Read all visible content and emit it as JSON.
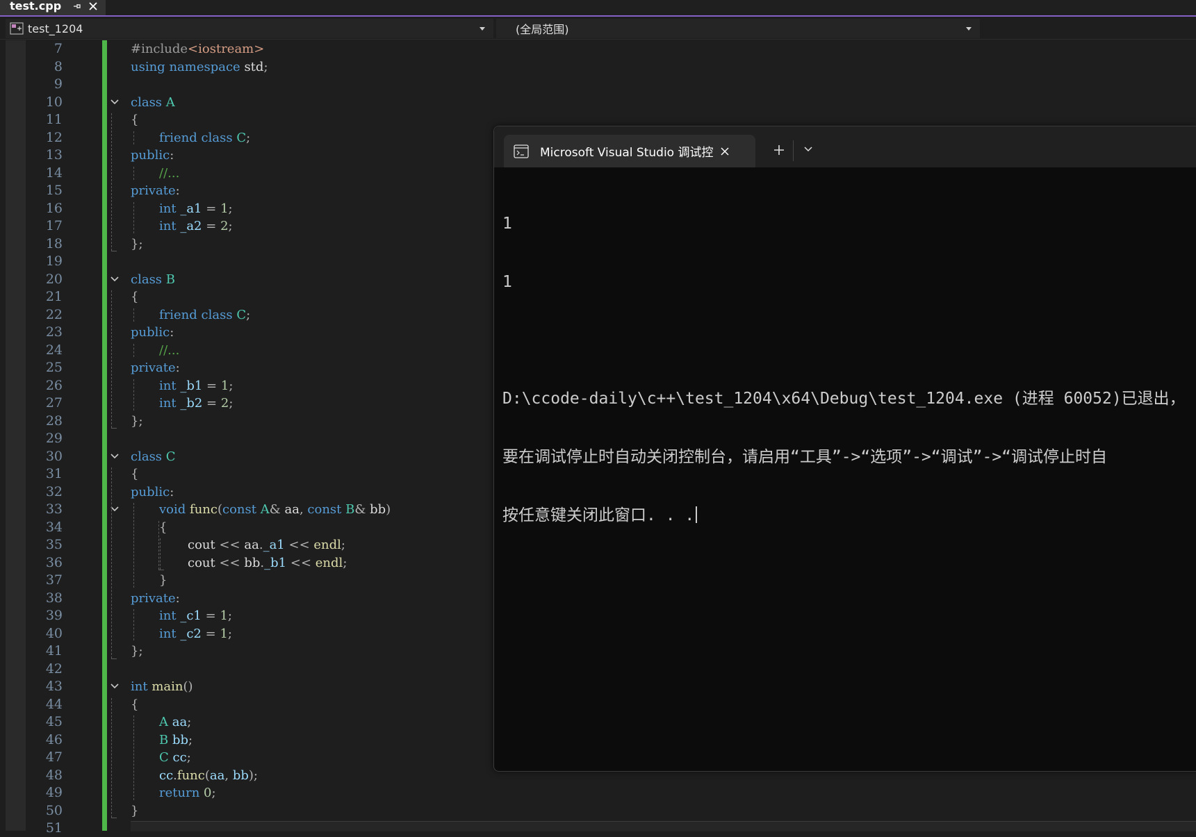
{
  "editor_tab": {
    "title": "test.cpp"
  },
  "navbar": {
    "project": "test_1204",
    "scope": "(全局范围)"
  },
  "editor": {
    "lines": [
      {
        "n": "7",
        "indent": 0,
        "tokens": [
          [
            "t-pre",
            "#include"
          ],
          [
            "t-str",
            "<iostream>"
          ]
        ]
      },
      {
        "n": "8",
        "indent": 0,
        "tokens": [
          [
            "t-kw",
            "using"
          ],
          [
            "t-pl",
            " "
          ],
          [
            "t-kw",
            "namespace"
          ],
          [
            "t-pl",
            " std"
          ],
          [
            "t-pun",
            ";"
          ]
        ]
      },
      {
        "n": "9",
        "indent": 0,
        "tokens": []
      },
      {
        "n": "10",
        "indent": 0,
        "fold": true,
        "tokens": [
          [
            "t-kw",
            "class"
          ],
          [
            "t-pl",
            " "
          ],
          [
            "t-type",
            "A"
          ]
        ]
      },
      {
        "n": "11",
        "indent": 0,
        "tokens": [
          [
            "t-pun",
            "{"
          ]
        ]
      },
      {
        "n": "12",
        "indent": 1,
        "tokens": [
          [
            "t-kw",
            "friend"
          ],
          [
            "t-pl",
            " "
          ],
          [
            "t-kw",
            "class"
          ],
          [
            "t-pl",
            " "
          ],
          [
            "t-type",
            "C"
          ],
          [
            "t-pun",
            ";"
          ]
        ]
      },
      {
        "n": "13",
        "indent": 0,
        "tokens": [
          [
            "t-kw",
            "public"
          ],
          [
            "t-pun",
            ":"
          ]
        ]
      },
      {
        "n": "14",
        "indent": 1,
        "tokens": [
          [
            "t-com",
            "//..."
          ]
        ]
      },
      {
        "n": "15",
        "indent": 0,
        "tokens": [
          [
            "t-kw",
            "private"
          ],
          [
            "t-pun",
            ":"
          ]
        ]
      },
      {
        "n": "16",
        "indent": 1,
        "tokens": [
          [
            "t-kw",
            "int"
          ],
          [
            "t-pl",
            " "
          ],
          [
            "t-var",
            "_a1"
          ],
          [
            "t-pl",
            " "
          ],
          [
            "t-pun",
            "="
          ],
          [
            "t-pl",
            " "
          ],
          [
            "t-num",
            "1"
          ],
          [
            "t-pun",
            ";"
          ]
        ]
      },
      {
        "n": "17",
        "indent": 1,
        "tokens": [
          [
            "t-kw",
            "int"
          ],
          [
            "t-pl",
            " "
          ],
          [
            "t-var",
            "_a2"
          ],
          [
            "t-pl",
            " "
          ],
          [
            "t-pun",
            "="
          ],
          [
            "t-pl",
            " "
          ],
          [
            "t-num",
            "2"
          ],
          [
            "t-pun",
            ";"
          ]
        ]
      },
      {
        "n": "18",
        "indent": 0,
        "tokens": [
          [
            "t-pun",
            "};"
          ]
        ]
      },
      {
        "n": "19",
        "indent": 0,
        "tokens": []
      },
      {
        "n": "20",
        "indent": 0,
        "fold": true,
        "tokens": [
          [
            "t-kw",
            "class"
          ],
          [
            "t-pl",
            " "
          ],
          [
            "t-type",
            "B"
          ]
        ]
      },
      {
        "n": "21",
        "indent": 0,
        "tokens": [
          [
            "t-pun",
            "{"
          ]
        ]
      },
      {
        "n": "22",
        "indent": 1,
        "tokens": [
          [
            "t-kw",
            "friend"
          ],
          [
            "t-pl",
            " "
          ],
          [
            "t-kw",
            "class"
          ],
          [
            "t-pl",
            " "
          ],
          [
            "t-type",
            "C"
          ],
          [
            "t-pun",
            ";"
          ]
        ]
      },
      {
        "n": "23",
        "indent": 0,
        "tokens": [
          [
            "t-kw",
            "public"
          ],
          [
            "t-pun",
            ":"
          ]
        ]
      },
      {
        "n": "24",
        "indent": 1,
        "tokens": [
          [
            "t-com",
            "//..."
          ]
        ]
      },
      {
        "n": "25",
        "indent": 0,
        "tokens": [
          [
            "t-kw",
            "private"
          ],
          [
            "t-pun",
            ":"
          ]
        ]
      },
      {
        "n": "26",
        "indent": 1,
        "tokens": [
          [
            "t-kw",
            "int"
          ],
          [
            "t-pl",
            " "
          ],
          [
            "t-var",
            "_b1"
          ],
          [
            "t-pl",
            " "
          ],
          [
            "t-pun",
            "="
          ],
          [
            "t-pl",
            " "
          ],
          [
            "t-num",
            "1"
          ],
          [
            "t-pun",
            ";"
          ]
        ]
      },
      {
        "n": "27",
        "indent": 1,
        "tokens": [
          [
            "t-kw",
            "int"
          ],
          [
            "t-pl",
            " "
          ],
          [
            "t-var",
            "_b2"
          ],
          [
            "t-pl",
            " "
          ],
          [
            "t-pun",
            "="
          ],
          [
            "t-pl",
            " "
          ],
          [
            "t-num",
            "2"
          ],
          [
            "t-pun",
            ";"
          ]
        ]
      },
      {
        "n": "28",
        "indent": 0,
        "tokens": [
          [
            "t-pun",
            "};"
          ]
        ]
      },
      {
        "n": "29",
        "indent": 0,
        "tokens": []
      },
      {
        "n": "30",
        "indent": 0,
        "fold": true,
        "tokens": [
          [
            "t-kw",
            "class"
          ],
          [
            "t-pl",
            " "
          ],
          [
            "t-type",
            "C"
          ]
        ]
      },
      {
        "n": "31",
        "indent": 0,
        "tokens": [
          [
            "t-pun",
            "{"
          ]
        ]
      },
      {
        "n": "32",
        "indent": 0,
        "tokens": [
          [
            "t-kw",
            "public"
          ],
          [
            "t-pun",
            ":"
          ]
        ]
      },
      {
        "n": "33",
        "indent": 1,
        "fold": true,
        "tokens": [
          [
            "t-kw",
            "void"
          ],
          [
            "t-pl",
            " "
          ],
          [
            "t-fn",
            "func"
          ],
          [
            "t-pun",
            "("
          ],
          [
            "t-kw",
            "const"
          ],
          [
            "t-pl",
            " "
          ],
          [
            "t-type",
            "A"
          ],
          [
            "t-pun",
            "&"
          ],
          [
            "t-pl",
            " aa"
          ],
          [
            "t-pun",
            ","
          ],
          [
            "t-pl",
            " "
          ],
          [
            "t-kw",
            "const"
          ],
          [
            "t-pl",
            " "
          ],
          [
            "t-type",
            "B"
          ],
          [
            "t-pun",
            "&"
          ],
          [
            "t-pl",
            " bb"
          ],
          [
            "t-pun",
            ")"
          ]
        ]
      },
      {
        "n": "34",
        "indent": 1,
        "tokens": [
          [
            "t-pun",
            "{"
          ]
        ]
      },
      {
        "n": "35",
        "indent": 2,
        "tokens": [
          [
            "t-pl",
            "cout "
          ],
          [
            "t-pun",
            "<<"
          ],
          [
            "t-pl",
            " aa"
          ],
          [
            "t-pun",
            "."
          ],
          [
            "t-var",
            "_a1"
          ],
          [
            "t-pl",
            " "
          ],
          [
            "t-pun",
            "<<"
          ],
          [
            "t-pl",
            " "
          ],
          [
            "t-fn",
            "endl"
          ],
          [
            "t-pun",
            ";"
          ]
        ]
      },
      {
        "n": "36",
        "indent": 2,
        "tokens": [
          [
            "t-pl",
            "cout "
          ],
          [
            "t-pun",
            "<<"
          ],
          [
            "t-pl",
            " bb"
          ],
          [
            "t-pun",
            "."
          ],
          [
            "t-var",
            "_b1"
          ],
          [
            "t-pl",
            " "
          ],
          [
            "t-pun",
            "<<"
          ],
          [
            "t-pl",
            " "
          ],
          [
            "t-fn",
            "endl"
          ],
          [
            "t-pun",
            ";"
          ]
        ]
      },
      {
        "n": "37",
        "indent": 1,
        "tokens": [
          [
            "t-pun",
            "}"
          ]
        ]
      },
      {
        "n": "38",
        "indent": 0,
        "tokens": [
          [
            "t-kw",
            "private"
          ],
          [
            "t-pun",
            ":"
          ]
        ]
      },
      {
        "n": "39",
        "indent": 1,
        "tokens": [
          [
            "t-kw",
            "int"
          ],
          [
            "t-pl",
            " "
          ],
          [
            "t-var",
            "_c1"
          ],
          [
            "t-pl",
            " "
          ],
          [
            "t-pun",
            "="
          ],
          [
            "t-pl",
            " "
          ],
          [
            "t-num",
            "1"
          ],
          [
            "t-pun",
            ";"
          ]
        ]
      },
      {
        "n": "40",
        "indent": 1,
        "tokens": [
          [
            "t-kw",
            "int"
          ],
          [
            "t-pl",
            " "
          ],
          [
            "t-var",
            "_c2"
          ],
          [
            "t-pl",
            " "
          ],
          [
            "t-pun",
            "="
          ],
          [
            "t-pl",
            " "
          ],
          [
            "t-num",
            "1"
          ],
          [
            "t-pun",
            ";"
          ]
        ]
      },
      {
        "n": "41",
        "indent": 0,
        "tokens": [
          [
            "t-pun",
            "};"
          ]
        ]
      },
      {
        "n": "42",
        "indent": 0,
        "tokens": []
      },
      {
        "n": "43",
        "indent": 0,
        "fold": true,
        "tokens": [
          [
            "t-kw",
            "int"
          ],
          [
            "t-pl",
            " "
          ],
          [
            "t-fn",
            "main"
          ],
          [
            "t-pun",
            "()"
          ]
        ]
      },
      {
        "n": "44",
        "indent": 0,
        "tokens": [
          [
            "t-pun",
            "{"
          ]
        ]
      },
      {
        "n": "45",
        "indent": 1,
        "tokens": [
          [
            "t-type",
            "A"
          ],
          [
            "t-pl",
            " "
          ],
          [
            "t-var",
            "aa"
          ],
          [
            "t-pun",
            ";"
          ]
        ]
      },
      {
        "n": "46",
        "indent": 1,
        "tokens": [
          [
            "t-type",
            "B"
          ],
          [
            "t-pl",
            " "
          ],
          [
            "t-var",
            "bb"
          ],
          [
            "t-pun",
            ";"
          ]
        ]
      },
      {
        "n": "47",
        "indent": 1,
        "tokens": [
          [
            "t-type",
            "C"
          ],
          [
            "t-pl",
            " "
          ],
          [
            "t-var",
            "cc"
          ],
          [
            "t-pun",
            ";"
          ]
        ]
      },
      {
        "n": "48",
        "indent": 1,
        "tokens": [
          [
            "t-var",
            "cc"
          ],
          [
            "t-pun",
            "."
          ],
          [
            "t-fn",
            "func"
          ],
          [
            "t-pun",
            "("
          ],
          [
            "t-var",
            "aa"
          ],
          [
            "t-pun",
            ","
          ],
          [
            "t-pl",
            " "
          ],
          [
            "t-var",
            "bb"
          ],
          [
            "t-pun",
            ");"
          ]
        ]
      },
      {
        "n": "49",
        "indent": 1,
        "tokens": [
          [
            "t-kw",
            "return"
          ],
          [
            "t-pl",
            " "
          ],
          [
            "t-num",
            "0"
          ],
          [
            "t-pun",
            ";"
          ]
        ]
      },
      {
        "n": "50",
        "indent": 0,
        "tokens": [
          [
            "t-pun",
            "}"
          ]
        ]
      },
      {
        "n": "51",
        "indent": 0,
        "tokens": []
      }
    ]
  },
  "console": {
    "tab_title": "Microsoft Visual Studio 调试控",
    "output": [
      "1",
      "1",
      "",
      "D:\\ccode-daily\\c++\\test_1204\\x64\\Debug\\test_1204.exe (进程 60052)已退出，",
      "要在调试停止时自动关闭控制台，请启用“工具”->“选项”->“调试”->“调试停止时自",
      "按任意键关闭此窗口. . ."
    ]
  },
  "icons": {
    "pin": "pin-icon",
    "close": "close-icon",
    "project": "cpp-project-icon",
    "dropdown": "chevron-down-icon",
    "fold": "fold-chevron-icon",
    "console": "console-icon",
    "new_tab": "plus-icon"
  },
  "colors": {
    "accent": "#8661c5",
    "change_bar": "#4fb64a",
    "keyword": "#569cd6",
    "type": "#4ec9b0",
    "function": "#dcdcaa",
    "variable": "#9cdcfe",
    "number": "#b5cea8",
    "comment": "#57a64a"
  }
}
